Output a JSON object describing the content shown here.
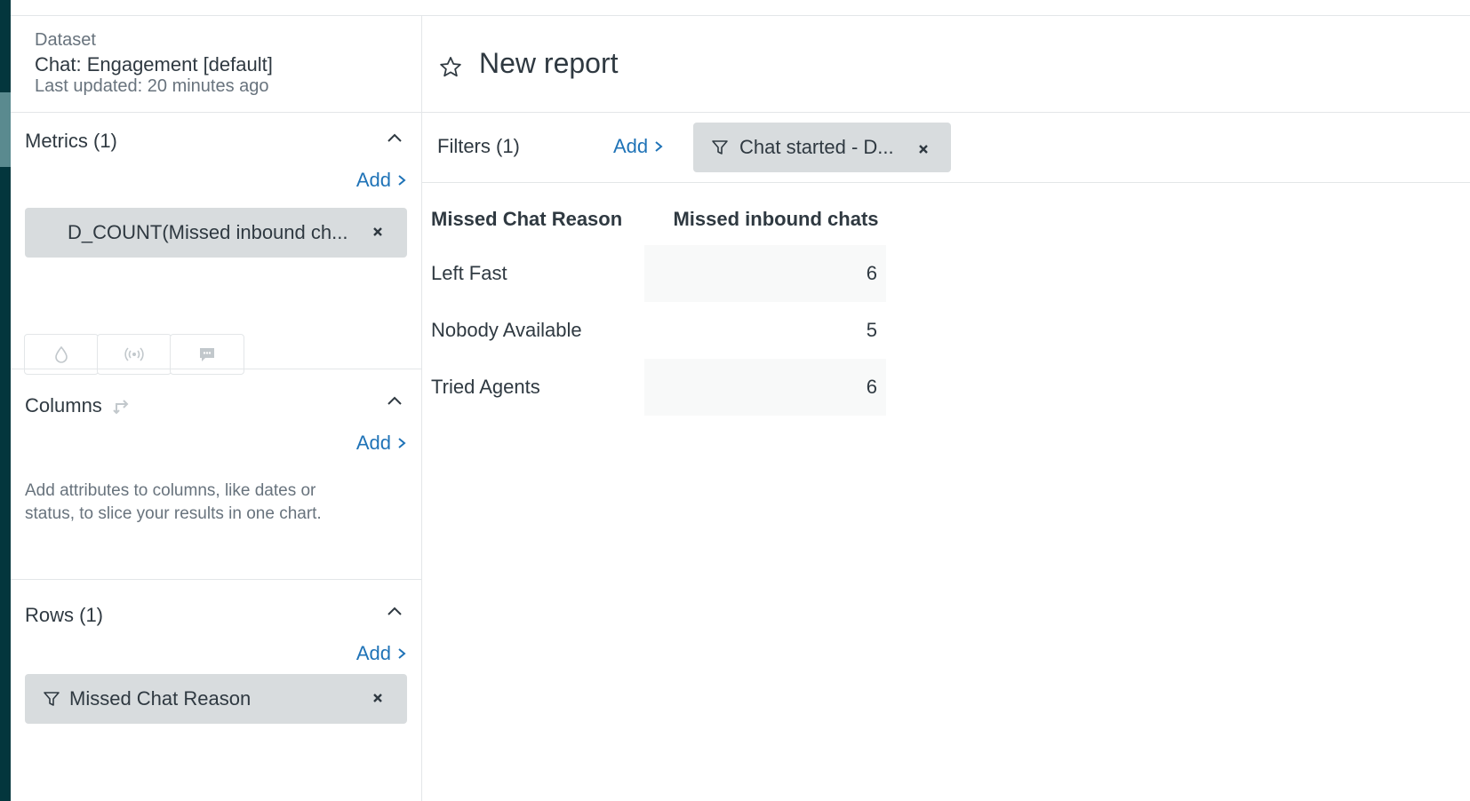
{
  "dataset": {
    "label": "Dataset",
    "name": "Chat: Engagement [default]",
    "updated": "Last updated: 20 minutes ago"
  },
  "report": {
    "title": "New report"
  },
  "metrics": {
    "title": "Metrics (1)",
    "add_label": "Add",
    "items": [
      "D_COUNT(Missed inbound ch..."
    ]
  },
  "visual_buttons": [
    "drop-icon",
    "broadcast-icon",
    "chat-icon"
  ],
  "columns": {
    "title": "Columns",
    "add_label": "Add",
    "hint": "Add attributes to columns, like dates or status, to slice your results in one chart."
  },
  "rows": {
    "title": "Rows (1)",
    "add_label": "Add",
    "items": [
      "Missed Chat Reason"
    ]
  },
  "filters": {
    "title": "Filters (1)",
    "add_label": "Add",
    "items": [
      "Chat started - D..."
    ]
  },
  "table": {
    "headers": [
      "Missed Chat Reason",
      "Missed inbound chats"
    ],
    "rows": [
      {
        "reason": "Left Fast",
        "count": "6"
      },
      {
        "reason": "Nobody Available",
        "count": "5"
      },
      {
        "reason": "Tried Agents",
        "count": "6"
      }
    ]
  },
  "colors": {
    "link": "#1f73b7",
    "pill": "#d8dcde",
    "nav": "#03363d"
  }
}
